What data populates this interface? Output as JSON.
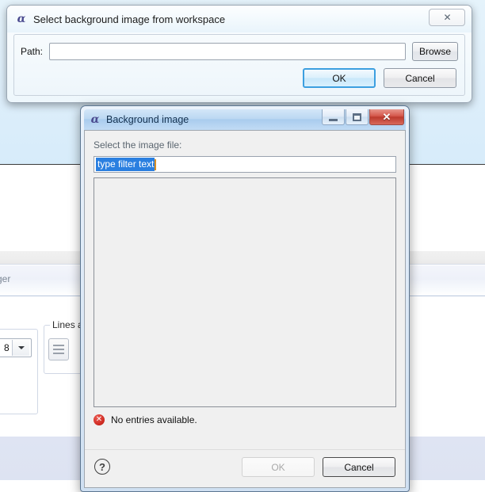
{
  "background_app": {
    "partial_label": "ger",
    "group_lines_label": "Lines a",
    "combo_value": "8",
    "lines_button_icon": "horizontal-lines-icon"
  },
  "dialog_workspace": {
    "title": "Select background image from workspace",
    "app_icon": "alpha-icon",
    "close_button_glyph": "✕",
    "path_label": "Path:",
    "path_value": "",
    "path_placeholder": "",
    "browse_label": "Browse",
    "ok_label": "OK",
    "cancel_label": "Cancel",
    "accent_focus_color": "#3c9fe0"
  },
  "dialog_background_image": {
    "title": "Background image",
    "app_icon": "alpha-icon",
    "window_controls": {
      "minimize": "minimize-icon",
      "maximize": "maximize-icon",
      "close": "✕"
    },
    "instruction_label": "Select the image file:",
    "filter_value": "type filter text",
    "filter_selected": true,
    "list_items": [],
    "status_icon": "error-icon",
    "status_text": "No entries available.",
    "help_label": "?",
    "ok_label": "OK",
    "ok_disabled": true,
    "cancel_label": "Cancel",
    "close_button_color": "#c0392b",
    "selection_color": "#2a7fe0",
    "error_color": "#cf2b22"
  }
}
